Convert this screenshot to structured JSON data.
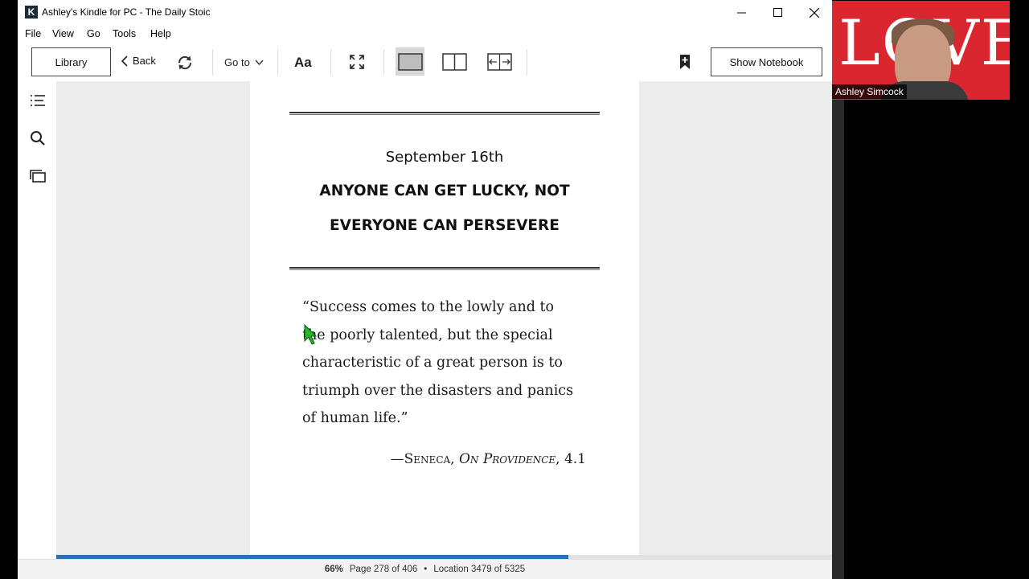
{
  "window": {
    "title": "Ashley's Kindle for PC - The Daily Stoic"
  },
  "menu": [
    "File",
    "View",
    "Go",
    "Tools",
    "Help"
  ],
  "toolbar": {
    "library_label": "Library",
    "back_label": "Back",
    "goto_label": "Go to",
    "font_label": "Aa",
    "notebook_label": "Show Notebook"
  },
  "page": {
    "date": "September 16th",
    "heading_line1": "ANYONE CAN GET LUCKY, NOT",
    "heading_line2": "EVERYONE CAN PERSEVERE",
    "quote_lines": [
      "“Success comes to the lowly and to",
      "the poorly talented, but the special",
      "characteristic of a great person is to",
      "triumph over the disasters and panics",
      "of human life.”"
    ],
    "attribution_dash": "—",
    "attribution_author": "Seneca",
    "attribution_sep": ", ",
    "attribution_work": "On Providence",
    "attribution_ref": ", 4.1"
  },
  "status": {
    "percent": "66%",
    "page": "Page 278 of 406",
    "bullet": "•",
    "location": "Location 3479 of 5325",
    "progress_fraction": 0.66
  },
  "webcam": {
    "background_text": "LOVE",
    "name": "Ashley Simcock"
  },
  "colors": {
    "progress": "#2c6fb0",
    "webcam_bg": "#d9262f"
  }
}
